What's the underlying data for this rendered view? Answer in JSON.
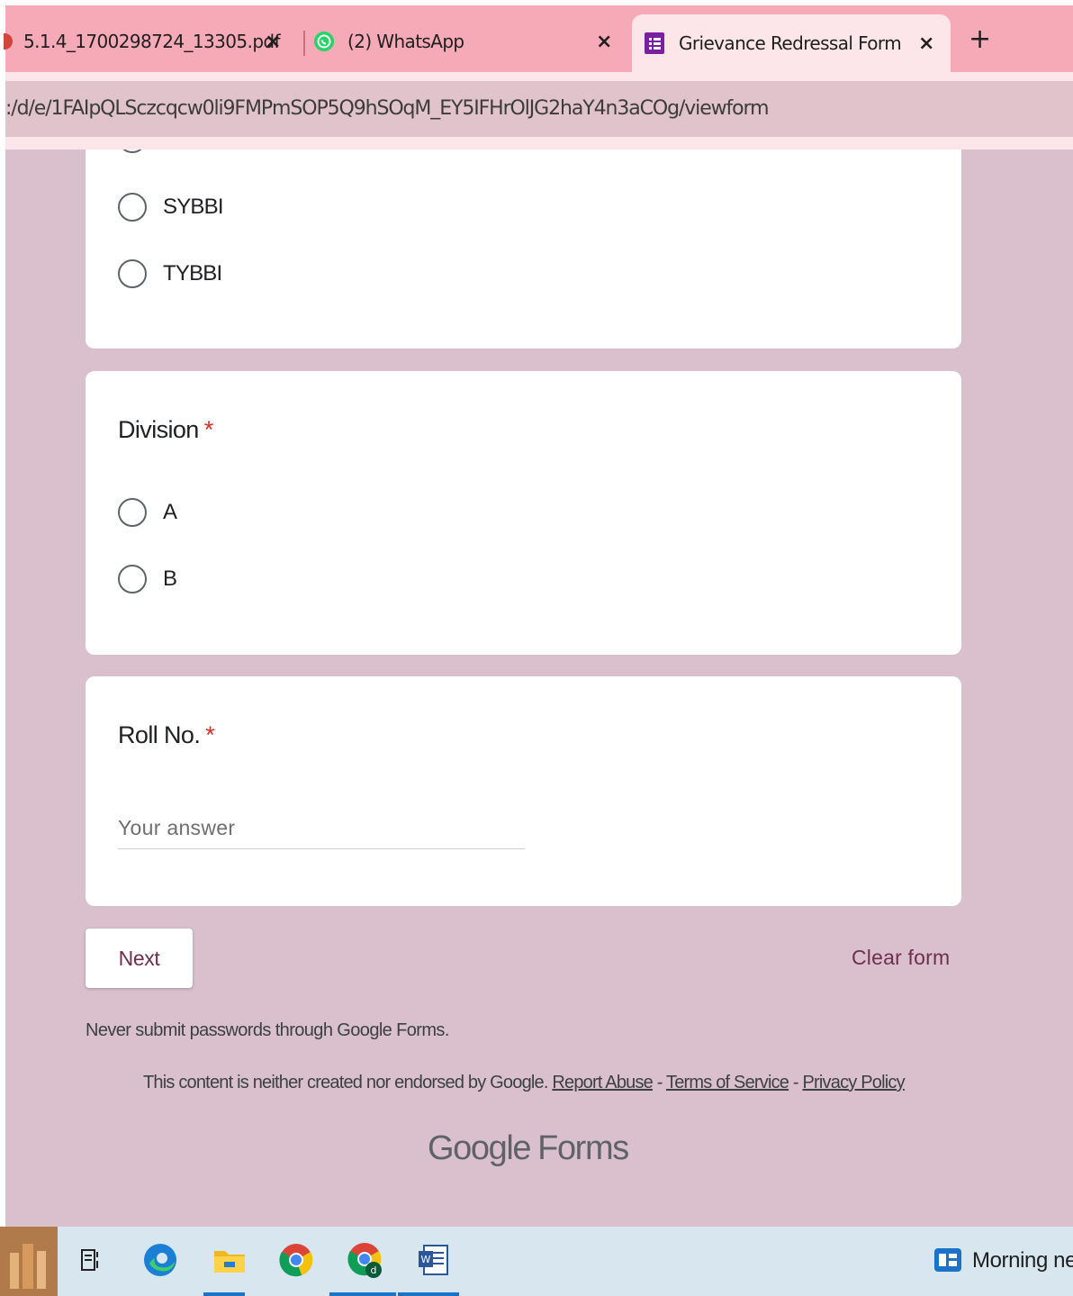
{
  "browser": {
    "tabs": [
      {
        "title": "5.1.4_1700298724_13305.pdf",
        "close": "×",
        "active": false
      },
      {
        "title": "(2) WhatsApp",
        "close": "×",
        "active": false
      },
      {
        "title": "Grievance Redressal Form",
        "close": "×",
        "active": true
      }
    ],
    "new_tab": "+",
    "url": ":/d/e/1FAIpQLSczcqcw0li9FMPmSOP5Q9hSOqM_EY5IFHrOlJG2haY4n3aCOg/viewform"
  },
  "form": {
    "class_options": [
      "SYBBI",
      "TYBBI"
    ],
    "division": {
      "title": "Division",
      "required_mark": "*",
      "options": [
        "A",
        "B"
      ]
    },
    "roll_no": {
      "title": "Roll No.",
      "required_mark": "*",
      "placeholder": "Your answer"
    },
    "next_label": "Next",
    "clear_label": "Clear form",
    "never_submit": "Never submit passwords through Google Forms.",
    "disclaimer": "This content is neither created nor endorsed by Google.",
    "links": {
      "report": "Report Abuse",
      "sep": " - ",
      "terms": "Terms of Service",
      "privacy": "Privacy Policy"
    },
    "brand": {
      "google": "Google",
      "forms": "Forms"
    }
  },
  "taskbar": {
    "widget_label": "Morning ne"
  },
  "colors": {
    "tabstrip": "#f6aab7",
    "page_bg": "#dac0cd",
    "accent": "#6e2f4f",
    "required": "#d93025"
  }
}
